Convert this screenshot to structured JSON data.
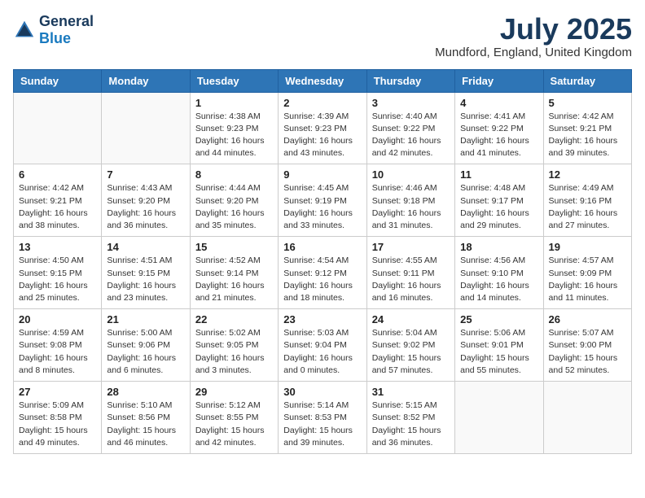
{
  "logo": {
    "general": "General",
    "blue": "Blue"
  },
  "title": {
    "month_year": "July 2025",
    "location": "Mundford, England, United Kingdom"
  },
  "weekdays": [
    "Sunday",
    "Monday",
    "Tuesday",
    "Wednesday",
    "Thursday",
    "Friday",
    "Saturday"
  ],
  "weeks": [
    [
      {
        "day": "",
        "detail": ""
      },
      {
        "day": "",
        "detail": ""
      },
      {
        "day": "1",
        "detail": "Sunrise: 4:38 AM\nSunset: 9:23 PM\nDaylight: 16 hours\nand 44 minutes."
      },
      {
        "day": "2",
        "detail": "Sunrise: 4:39 AM\nSunset: 9:23 PM\nDaylight: 16 hours\nand 43 minutes."
      },
      {
        "day": "3",
        "detail": "Sunrise: 4:40 AM\nSunset: 9:22 PM\nDaylight: 16 hours\nand 42 minutes."
      },
      {
        "day": "4",
        "detail": "Sunrise: 4:41 AM\nSunset: 9:22 PM\nDaylight: 16 hours\nand 41 minutes."
      },
      {
        "day": "5",
        "detail": "Sunrise: 4:42 AM\nSunset: 9:21 PM\nDaylight: 16 hours\nand 39 minutes."
      }
    ],
    [
      {
        "day": "6",
        "detail": "Sunrise: 4:42 AM\nSunset: 9:21 PM\nDaylight: 16 hours\nand 38 minutes."
      },
      {
        "day": "7",
        "detail": "Sunrise: 4:43 AM\nSunset: 9:20 PM\nDaylight: 16 hours\nand 36 minutes."
      },
      {
        "day": "8",
        "detail": "Sunrise: 4:44 AM\nSunset: 9:20 PM\nDaylight: 16 hours\nand 35 minutes."
      },
      {
        "day": "9",
        "detail": "Sunrise: 4:45 AM\nSunset: 9:19 PM\nDaylight: 16 hours\nand 33 minutes."
      },
      {
        "day": "10",
        "detail": "Sunrise: 4:46 AM\nSunset: 9:18 PM\nDaylight: 16 hours\nand 31 minutes."
      },
      {
        "day": "11",
        "detail": "Sunrise: 4:48 AM\nSunset: 9:17 PM\nDaylight: 16 hours\nand 29 minutes."
      },
      {
        "day": "12",
        "detail": "Sunrise: 4:49 AM\nSunset: 9:16 PM\nDaylight: 16 hours\nand 27 minutes."
      }
    ],
    [
      {
        "day": "13",
        "detail": "Sunrise: 4:50 AM\nSunset: 9:15 PM\nDaylight: 16 hours\nand 25 minutes."
      },
      {
        "day": "14",
        "detail": "Sunrise: 4:51 AM\nSunset: 9:15 PM\nDaylight: 16 hours\nand 23 minutes."
      },
      {
        "day": "15",
        "detail": "Sunrise: 4:52 AM\nSunset: 9:14 PM\nDaylight: 16 hours\nand 21 minutes."
      },
      {
        "day": "16",
        "detail": "Sunrise: 4:54 AM\nSunset: 9:12 PM\nDaylight: 16 hours\nand 18 minutes."
      },
      {
        "day": "17",
        "detail": "Sunrise: 4:55 AM\nSunset: 9:11 PM\nDaylight: 16 hours\nand 16 minutes."
      },
      {
        "day": "18",
        "detail": "Sunrise: 4:56 AM\nSunset: 9:10 PM\nDaylight: 16 hours\nand 14 minutes."
      },
      {
        "day": "19",
        "detail": "Sunrise: 4:57 AM\nSunset: 9:09 PM\nDaylight: 16 hours\nand 11 minutes."
      }
    ],
    [
      {
        "day": "20",
        "detail": "Sunrise: 4:59 AM\nSunset: 9:08 PM\nDaylight: 16 hours\nand 8 minutes."
      },
      {
        "day": "21",
        "detail": "Sunrise: 5:00 AM\nSunset: 9:06 PM\nDaylight: 16 hours\nand 6 minutes."
      },
      {
        "day": "22",
        "detail": "Sunrise: 5:02 AM\nSunset: 9:05 PM\nDaylight: 16 hours\nand 3 minutes."
      },
      {
        "day": "23",
        "detail": "Sunrise: 5:03 AM\nSunset: 9:04 PM\nDaylight: 16 hours\nand 0 minutes."
      },
      {
        "day": "24",
        "detail": "Sunrise: 5:04 AM\nSunset: 9:02 PM\nDaylight: 15 hours\nand 57 minutes."
      },
      {
        "day": "25",
        "detail": "Sunrise: 5:06 AM\nSunset: 9:01 PM\nDaylight: 15 hours\nand 55 minutes."
      },
      {
        "day": "26",
        "detail": "Sunrise: 5:07 AM\nSunset: 9:00 PM\nDaylight: 15 hours\nand 52 minutes."
      }
    ],
    [
      {
        "day": "27",
        "detail": "Sunrise: 5:09 AM\nSunset: 8:58 PM\nDaylight: 15 hours\nand 49 minutes."
      },
      {
        "day": "28",
        "detail": "Sunrise: 5:10 AM\nSunset: 8:56 PM\nDaylight: 15 hours\nand 46 minutes."
      },
      {
        "day": "29",
        "detail": "Sunrise: 5:12 AM\nSunset: 8:55 PM\nDaylight: 15 hours\nand 42 minutes."
      },
      {
        "day": "30",
        "detail": "Sunrise: 5:14 AM\nSunset: 8:53 PM\nDaylight: 15 hours\nand 39 minutes."
      },
      {
        "day": "31",
        "detail": "Sunrise: 5:15 AM\nSunset: 8:52 PM\nDaylight: 15 hours\nand 36 minutes."
      },
      {
        "day": "",
        "detail": ""
      },
      {
        "day": "",
        "detail": ""
      }
    ]
  ]
}
